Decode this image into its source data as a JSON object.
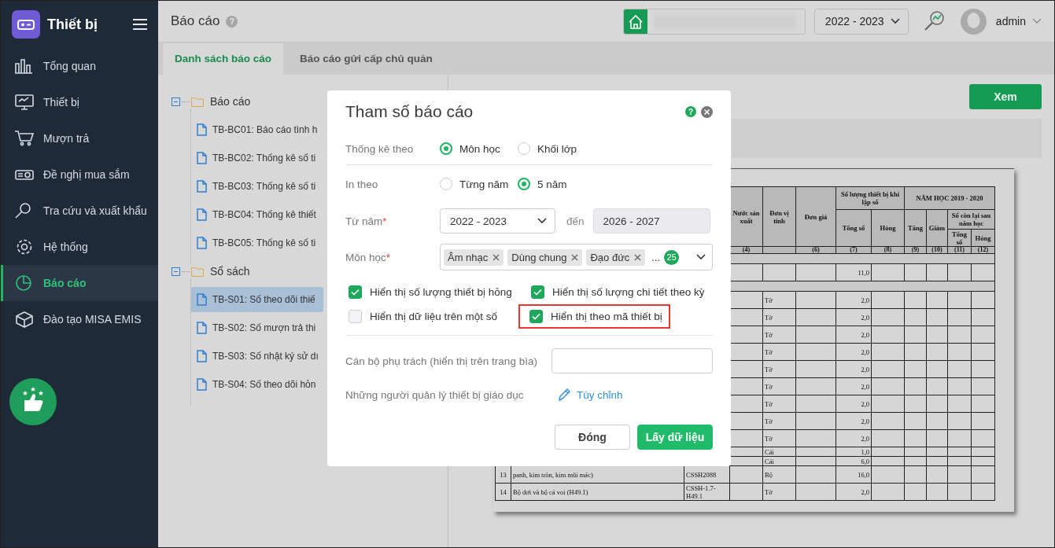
{
  "sidebar": {
    "app_name": "Thiết bị",
    "items": [
      {
        "label": "Tổng quan",
        "selected": false
      },
      {
        "label": "Thiết bị",
        "selected": false
      },
      {
        "label": "Mượn trả",
        "selected": false
      },
      {
        "label": "Đề nghị mua sắm",
        "selected": false
      },
      {
        "label": "Tra cứu và xuất khẩu",
        "selected": false
      },
      {
        "label": "Hệ thống",
        "selected": false
      },
      {
        "label": "Báo cáo",
        "selected": true
      },
      {
        "label": "Đào tạo MISA EMIS",
        "selected": false
      }
    ]
  },
  "header": {
    "title": "Báo cáo",
    "help": "?",
    "school_year": "2022 - 2023",
    "user": "admin"
  },
  "tabs": [
    {
      "label": "Danh sách báo cáo",
      "selected": true
    },
    {
      "label": "Báo cáo gửi cấp chủ quản",
      "selected": false
    }
  ],
  "tree": [
    {
      "label": "Báo cáo",
      "expanded": true,
      "children": [
        {
          "label": "TB-BC01: Báo cáo tình h",
          "selected": false
        },
        {
          "label": "TB-BC02: Thống kê số ti",
          "selected": false
        },
        {
          "label": "TB-BC03: Thống kê số ti",
          "selected": false
        },
        {
          "label": "TB-BC04: Thống kê thiết",
          "selected": false
        },
        {
          "label": "TB-BC05: Thống kê số ti",
          "selected": false
        }
      ]
    },
    {
      "label": "Sổ sách",
      "expanded": true,
      "children": [
        {
          "label": "TB-S01: Số theo dõi thiế",
          "selected": true
        },
        {
          "label": "TB-S02: Số mượn trả thi",
          "selected": false
        },
        {
          "label": "TB-S03: Số nhật ký sử dı",
          "selected": false
        },
        {
          "label": "TB-S04: Số theo dõi hỏn",
          "selected": false
        }
      ]
    }
  ],
  "view_button": "Xem",
  "document": {
    "columns": [
      {
        "label": "Nước sản xuất",
        "number": "(4)"
      },
      {
        "label": "Đơn vị tính"
      },
      {
        "label": "Đơn giá",
        "number": "(6)"
      }
    ],
    "group_1": {
      "label": "Số lượng thiết bị khi lập số",
      "columns": [
        {
          "label": "Tổng số",
          "number": "(7)"
        },
        {
          "label": "Hỏng",
          "number": "(8)"
        }
      ]
    },
    "group_2": {
      "label": "NĂM HỌC 2019 - 2020",
      "columns": [
        {
          "label": "Tăng",
          "number": "(9)"
        },
        {
          "label": "Giảm",
          "number": "(10)"
        }
      ],
      "subgroup": {
        "label": "Số còn lại sau năm học",
        "columns": [
          {
            "label": "Tổng số",
            "number": "(11)"
          },
          {
            "label": "Hỏng",
            "number": "(12)"
          }
        ]
      }
    },
    "rows": [
      {
        "kind": "band"
      },
      {
        "kind": "item",
        "total": "11,0"
      },
      {
        "kind": "band"
      },
      {
        "kind": "item",
        "unit": "Tờ",
        "total": "2,0"
      },
      {
        "kind": "item",
        "unit": "Tờ",
        "total": "2,0"
      },
      {
        "kind": "item",
        "unit": "Tờ",
        "total": "2,0"
      },
      {
        "kind": "item",
        "unit": "Tờ",
        "total": "2,0"
      },
      {
        "kind": "item",
        "unit": "Tờ",
        "total": "2,0"
      },
      {
        "kind": "item",
        "unit": "Tờ",
        "total": "2,0"
      },
      {
        "kind": "item",
        "unit": "Tờ",
        "total": "2,0"
      },
      {
        "kind": "item",
        "unit": "Tờ",
        "total": "2,0"
      },
      {
        "kind": "item",
        "unit": "Tờ",
        "total": "2,0"
      },
      {
        "kind": "thin",
        "unit": "Cái",
        "total": "1,0"
      },
      {
        "kind": "thin",
        "unit": "Cái",
        "total": "6,0"
      },
      {
        "kind": "item",
        "index": "13",
        "name": "panh, kim tròn, kim mũi mác)",
        "code": "CSSH2088",
        "unit": "Bộ",
        "total": "16,0"
      },
      {
        "kind": "item",
        "index": "14",
        "name": "Bộ dơi và bộ cá voi (H49.1)",
        "code": "CSSH-1.7-H49.1",
        "unit": "Tờ",
        "total": "2,0"
      }
    ]
  },
  "dialog": {
    "title": "Tham số báo cáo",
    "help": "?",
    "group_by": {
      "label": "Thống kê theo",
      "options": [
        {
          "label": "Môn học",
          "selected": true
        },
        {
          "label": "Khối lớp",
          "selected": false
        }
      ]
    },
    "print_by": {
      "label": "In theo",
      "options": [
        {
          "label": "Từng năm",
          "selected": false
        },
        {
          "label": "5 năm",
          "selected": true
        }
      ]
    },
    "from_year": {
      "label": "Từ năm",
      "required_mark": "*",
      "value": "2022 - 2023",
      "to_label": "đến",
      "to_value": "2026 - 2027"
    },
    "subjects": {
      "label": "Môn học",
      "required_mark": "*",
      "tags": [
        "Âm nhạc",
        "Dùng chung",
        "Đạo đức"
      ],
      "more": "...",
      "count": "25"
    },
    "options": [
      {
        "label": "Hiển thị số lượng thiết bị hỏng",
        "checked": true,
        "highlighted": false
      },
      {
        "label": "Hiển thị số lượng chi tiết theo kỳ",
        "checked": true,
        "highlighted": false
      },
      {
        "label": "Hiển thị dữ liệu trên một số",
        "checked": false,
        "highlighted": false
      },
      {
        "label": "Hiển thị theo mã thiết bị",
        "checked": true,
        "highlighted": true
      }
    ],
    "officer": {
      "label": "Cán bộ phụ trách (hiển thị trên trang bìa)"
    },
    "managers": {
      "label": "Những người quản lý thiết bị giáo dục",
      "link": "Tùy chỉnh"
    },
    "buttons": [
      {
        "label": "Đóng",
        "kind": "secondary"
      },
      {
        "label": "Lấy dữ liệu",
        "kind": "primary"
      }
    ]
  }
}
